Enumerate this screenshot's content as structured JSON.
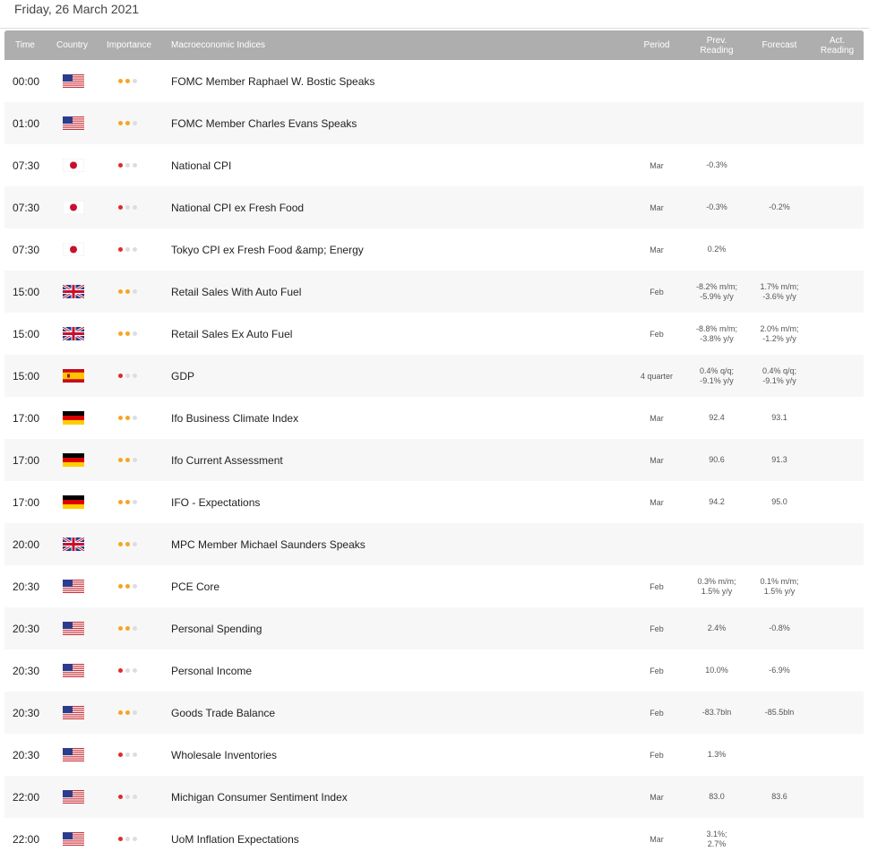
{
  "date_title": "Friday, 26 March 2021",
  "columns": {
    "time": "Time",
    "country": "Country",
    "importance": "Importance",
    "indices": "Macroeconomic Indices",
    "period": "Period",
    "prev": [
      "Prev.",
      "Reading"
    ],
    "forecast": "Forecast",
    "actual": [
      "Act.",
      "Reading"
    ]
  },
  "colors": {
    "header_bg": "#aeaeae",
    "high_importance": "#e02a2a",
    "medium_importance": "#f5a623",
    "inactive_dot": "#dddddd"
  },
  "rows": [
    {
      "time": "00:00",
      "country": "us",
      "importance": "medium",
      "name": "FOMC Member Raphael W. Bostic Speaks",
      "period": "",
      "prev": [],
      "forecast": [],
      "actual": ""
    },
    {
      "time": "01:00",
      "country": "us",
      "importance": "medium",
      "name": "FOMC Member Charles Evans Speaks",
      "period": "",
      "prev": [],
      "forecast": [],
      "actual": ""
    },
    {
      "time": "07:30",
      "country": "jp",
      "importance": "high",
      "name": "National CPI",
      "period": "Mar",
      "prev": [
        "-0.3%"
      ],
      "forecast": [],
      "actual": ""
    },
    {
      "time": "07:30",
      "country": "jp",
      "importance": "high",
      "name": "National CPI ex Fresh Food",
      "period": "Mar",
      "prev": [
        "-0.3%"
      ],
      "forecast": [
        "-0.2%"
      ],
      "actual": ""
    },
    {
      "time": "07:30",
      "country": "jp",
      "importance": "high",
      "name": "Tokyo CPI ex Fresh Food &amp; Energy",
      "period": "Mar",
      "prev": [
        "0.2%"
      ],
      "forecast": [],
      "actual": ""
    },
    {
      "time": "15:00",
      "country": "gb",
      "importance": "medium",
      "name": "Retail Sales With Auto Fuel",
      "period": "Feb",
      "prev": [
        "-8.2% m/m;",
        "-5.9% y/y"
      ],
      "forecast": [
        "1.7% m/m;",
        "-3.6% y/y"
      ],
      "actual": ""
    },
    {
      "time": "15:00",
      "country": "gb",
      "importance": "medium",
      "name": "Retail Sales Ex Auto Fuel",
      "period": "Feb",
      "prev": [
        "-8.8% m/m;",
        "-3.8% y/y"
      ],
      "forecast": [
        "2.0% m/m;",
        "-1.2% y/y"
      ],
      "actual": ""
    },
    {
      "time": "15:00",
      "country": "es",
      "importance": "high",
      "name": "GDP",
      "period": "4 quarter",
      "prev": [
        "0.4% q/q;",
        "-9.1% y/y"
      ],
      "forecast": [
        "0.4% q/q;",
        "-9.1% y/y"
      ],
      "actual": ""
    },
    {
      "time": "17:00",
      "country": "de",
      "importance": "medium",
      "name": "Ifo Business Climate Index",
      "period": "Mar",
      "prev": [
        "92.4"
      ],
      "forecast": [
        "93.1"
      ],
      "actual": ""
    },
    {
      "time": "17:00",
      "country": "de",
      "importance": "medium",
      "name": "Ifo Current Assessment",
      "period": "Mar",
      "prev": [
        "90.6"
      ],
      "forecast": [
        "91.3"
      ],
      "actual": ""
    },
    {
      "time": "17:00",
      "country": "de",
      "importance": "medium",
      "name": "IFO - Expectations",
      "period": "Mar",
      "prev": [
        "94.2"
      ],
      "forecast": [
        "95.0"
      ],
      "actual": ""
    },
    {
      "time": "20:00",
      "country": "gb",
      "importance": "medium",
      "name": "MPC Member Michael Saunders Speaks",
      "period": "",
      "prev": [],
      "forecast": [],
      "actual": ""
    },
    {
      "time": "20:30",
      "country": "us",
      "importance": "medium",
      "name": "PCE Core",
      "period": "Feb",
      "prev": [
        "0.3% m/m;",
        "1.5% y/y"
      ],
      "forecast": [
        "0.1% m/m;",
        "1.5% y/y"
      ],
      "actual": ""
    },
    {
      "time": "20:30",
      "country": "us",
      "importance": "medium",
      "name": "Personal Spending",
      "period": "Feb",
      "prev": [
        "2.4%"
      ],
      "forecast": [
        "-0.8%"
      ],
      "actual": ""
    },
    {
      "time": "20:30",
      "country": "us",
      "importance": "high",
      "name": "Personal Income",
      "period": "Feb",
      "prev": [
        "10.0%"
      ],
      "forecast": [
        "-6.9%"
      ],
      "actual": ""
    },
    {
      "time": "20:30",
      "country": "us",
      "importance": "medium",
      "name": "Goods Trade Balance",
      "period": "Feb",
      "prev": [
        "-83.7bln"
      ],
      "forecast": [
        "-85.5bln"
      ],
      "actual": ""
    },
    {
      "time": "20:30",
      "country": "us",
      "importance": "high",
      "name": "Wholesale Inventories",
      "period": "Feb",
      "prev": [
        "1.3%"
      ],
      "forecast": [],
      "actual": ""
    },
    {
      "time": "22:00",
      "country": "us",
      "importance": "high",
      "name": "Michigan Consumer Sentiment Index",
      "period": "Mar",
      "prev": [
        "83.0"
      ],
      "forecast": [
        "83.6"
      ],
      "actual": ""
    },
    {
      "time": "22:00",
      "country": "us",
      "importance": "high",
      "name": "UoM Inflation Expectations",
      "period": "Mar",
      "prev": [
        "3.1%;",
        "2.7%"
      ],
      "forecast": [],
      "actual": ""
    }
  ]
}
